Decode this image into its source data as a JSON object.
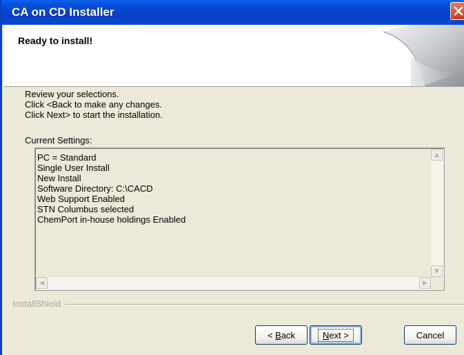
{
  "window": {
    "title": "CA on CD Installer"
  },
  "header": {
    "heading": "Ready to install!"
  },
  "instructions": [
    "Review your selections.",
    "Click <Back to make any changes.",
    "Click Next> to start the installation."
  ],
  "current_settings": {
    "label": "Current Settings:",
    "lines": [
      "PC = Standard",
      "Single User Install",
      "New Install",
      "Software Directory: C:\\CACD",
      "Web Support Enabled",
      "STN Columbus selected",
      "ChemPort in-house holdings Enabled"
    ]
  },
  "footer": {
    "brand": "InstallShield"
  },
  "buttons": {
    "back_accel": "B",
    "back_rest": "ack",
    "back_prefix": "< ",
    "next_accel": "N",
    "next_rest": "ext >",
    "cancel": "Cancel"
  },
  "colors": {
    "titlebar": "#0a48d0",
    "dialog_bg": "#ece9d8",
    "close_button": "#c83a1c"
  },
  "icons": {
    "close": "close-x-icon",
    "header_logo": "page-curl-logo"
  }
}
